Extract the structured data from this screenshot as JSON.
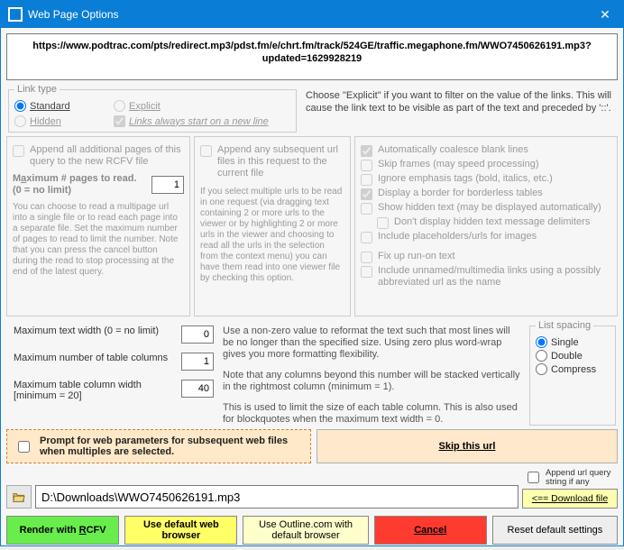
{
  "title": "Web Page Options",
  "url": "https://www.podtrac.com/pts/redirect.mp3/pdst.fm/e/chrt.fm/track/524GE/traffic.megaphone.fm/WWO7450626191.mp3?updated=1629928219",
  "linktype": {
    "legend": "Link type",
    "r1": "Standard",
    "r2": "Explicit",
    "r3": "Hidden",
    "r4": "Links always start on a new line",
    "selected": "Standard"
  },
  "explicit_desc": "Choose \"Explicit\" if you want to filter on the value of the links. This will cause the link text to be visible as part of the text and preceded by '::'.",
  "pane1": {
    "chk": "Append all additional pages of this query to the new RCFV file",
    "maxlabel_pre": "M",
    "maxlabel_u": "a",
    "maxlabel_post": "ximum # pages to read.  (0 = no limit)",
    "val": "1",
    "help": "You can choose to read a multipage url into a single file or to read each page into a separate file.  Set the maximum number of pages to read to limit the number.  Note that you can press the cancel button during the read to stop processing at the end of the latest query."
  },
  "pane2": {
    "chk": "Append any subsequent url files in this request to the current file",
    "help": "If you select multiple urls to be read in one request (via dragging text containing 2 or more urls to the viewer or by highlighting 2 or more urls in the viewer and choosing to read all the urls in the selection from the context menu) you can have them read into one viewer file by checking this option."
  },
  "pane3": {
    "c1": "Automatically coalesce blank lines",
    "c2": "Skip frames (may speed processing)",
    "c3": "Ignore emphasis tags (bold, italics, etc.)",
    "c4": "Display a border for borderless tables",
    "c5": "Show hidden text (may be displayed automatically)",
    "c5a": "Don't display hidden text message delimiters",
    "c6": "Include placeholders/urls for images",
    "c7": "Fix up run-on text",
    "c8": "Include unnamed/multimedia links using a possibly abbreviated url as the name"
  },
  "max": {
    "l1": "Maximum text width  (0 = no limit)",
    "v1": "0",
    "l2": "Maximum number of table columns",
    "v2": "1",
    "l3": "Maximum table column width [minimum = 20]",
    "v3": "40",
    "d1": "Use a non-zero value to reformat the text such that most lines will be no longer than the specified size. Using zero plus word-wrap gives you more formatting flexibility.",
    "d2": "Note that any columns beyond this number will be stacked vertically in the rightmost column (minimum = 1).",
    "d3": "This is used to limit the size of each table column. This is also used for blockquotes when the maximum text width = 0."
  },
  "listspacing": {
    "legend": "List spacing",
    "r1": "Single",
    "r2": "Double",
    "r3": "Compress"
  },
  "promptparams": "Prompt for web parameters for subsequent web files when multiples are selected.",
  "skip": "Skip this url",
  "appendq": "Append url query string if any",
  "dlbtn": "<== Download file",
  "path": "D:\\Downloads\\WWO7450626191.mp3",
  "buttons": {
    "b1_pre": "Render with ",
    "b1_u": "R",
    "b1_post": "CFV",
    "b2": "Use default web browser",
    "b3": "Use Outline.com with default browser",
    "b4": "Cancel",
    "b5": "Reset default settings"
  }
}
